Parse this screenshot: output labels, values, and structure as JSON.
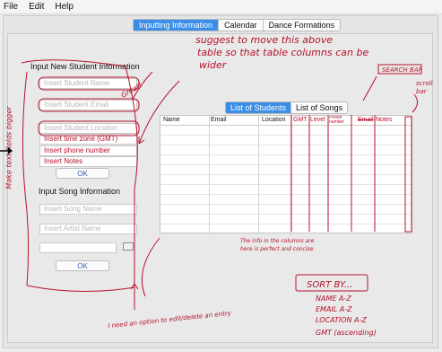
{
  "menu": [
    "File",
    "Edit",
    "Help"
  ],
  "main_tabs": [
    "Inputting Information",
    "Calendar",
    "Dance Formations"
  ],
  "student_section": {
    "title": "Input New Student Information",
    "fields": [
      "Insert Student Name",
      "Insert Student Email",
      "Insert Student Location",
      "Insert time zone (GMT)",
      "Insert phone number",
      "Insert Notes"
    ],
    "ok_label": "OK"
  },
  "song_section": {
    "title": "Input Song Information",
    "fields": [
      "Insert Song Name",
      "Insert Artist Name",
      ""
    ],
    "ok_label": "OK"
  },
  "list_tabs": [
    "List of Students",
    "List of Songs"
  ],
  "table": {
    "columns": [
      "Name",
      "Email",
      "Location",
      "GMT",
      "Level",
      "Phone number",
      "Email",
      "Notes"
    ]
  },
  "annotations": {
    "top": [
      "suggest to move this above",
      "table so that table columns can be",
      "wider"
    ],
    "great": "Great!",
    "left_side": "Make text fields bigger",
    "search": "SEARCH BAR",
    "scroll": [
      "scroll",
      "bar"
    ],
    "table_note": [
      "The info in the columns are",
      "here is perfect and concise."
    ],
    "sort": [
      "SORT BY...",
      "NAME A-Z",
      "EMAIL A-Z",
      "LOCATION A-Z",
      "GMT (ascending)"
    ],
    "edit": "I need an option to edit/delete an entry"
  },
  "colors": {
    "accent": "#3b8ee8",
    "ink": "#b6122b"
  }
}
